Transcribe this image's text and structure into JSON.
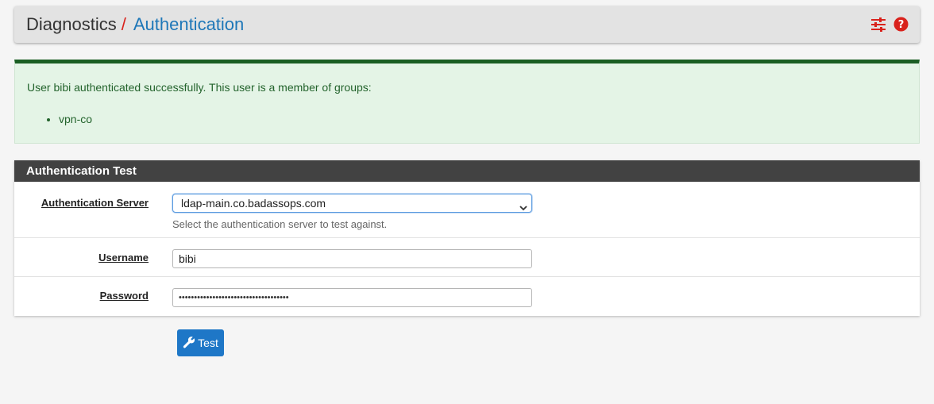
{
  "breadcrumb": {
    "root": "Diagnostics",
    "separator": "/",
    "current": "Authentication"
  },
  "header_icons": [
    "sliders-icon",
    "help-circle-icon"
  ],
  "colors": {
    "accent": "#1e77b8",
    "danger": "#d9221c",
    "success_border": "#1a5e23",
    "panel_heading": "#424242",
    "button": "#1e77c7"
  },
  "alert": {
    "message": "User bibi authenticated successfully. This user is a member of groups:",
    "groups": [
      "vpn-co"
    ]
  },
  "panel": {
    "title": "Authentication Test",
    "server": {
      "label": "Authentication Server",
      "value": "ldap-main.co.badassops.com",
      "help": "Select the authentication server to test against."
    },
    "username": {
      "label": "Username",
      "value": "bibi"
    },
    "password": {
      "label": "Password",
      "value": "••••••••••••••••••••••••••••••••••••"
    }
  },
  "actions": {
    "test_label": "Test",
    "test_icon": "wrench-icon"
  }
}
